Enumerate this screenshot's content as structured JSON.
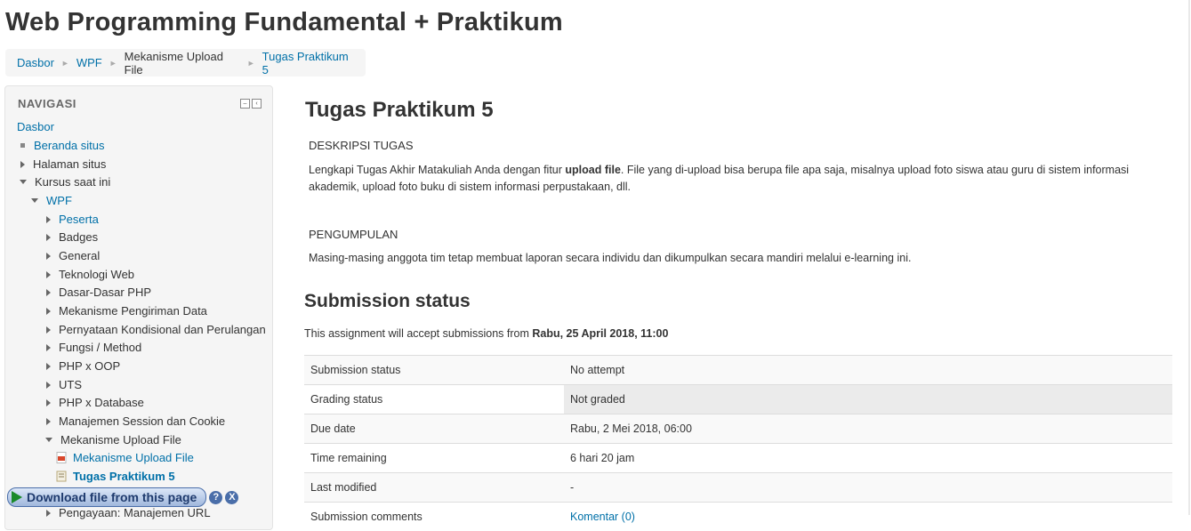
{
  "page": {
    "title": "Web Programming Fundamental + Praktikum"
  },
  "breadcrumb": {
    "items": [
      {
        "label": "Dasbor"
      },
      {
        "label": "WPF"
      },
      {
        "label": "Mekanisme Upload File"
      },
      {
        "label": "Tugas Praktikum 5"
      }
    ],
    "separator": "►"
  },
  "nav": {
    "header": "NAVIGASI",
    "items": [
      {
        "label": "Dasbor"
      },
      {
        "label": "Beranda situs"
      },
      {
        "label": "Halaman situs"
      },
      {
        "label": "Kursus saat ini"
      },
      {
        "label": "WPF"
      },
      {
        "label": "Peserta"
      },
      {
        "label": "Badges"
      },
      {
        "label": "General"
      },
      {
        "label": "Teknologi Web"
      },
      {
        "label": "Dasar-Dasar PHP"
      },
      {
        "label": "Mekanisme Pengiriman Data"
      },
      {
        "label": "Pernyataan Kondisional dan Perulangan"
      },
      {
        "label": "Fungsi / Method"
      },
      {
        "label": "PHP x OOP"
      },
      {
        "label": "UTS"
      },
      {
        "label": "PHP x Database"
      },
      {
        "label": "Manajemen Session dan Cookie"
      },
      {
        "label": "Mekanisme Upload File"
      },
      {
        "label": "Mekanisme Upload File"
      },
      {
        "label": "Tugas Praktikum 5"
      },
      {
        "label": "Pengayaan: Manajemen URL"
      }
    ]
  },
  "download_bar": {
    "label": "Download file from this page",
    "help": "?",
    "close": "X"
  },
  "assignment": {
    "title": "Tugas Praktikum 5",
    "desc_heading": "DESKRIPSI TUGAS",
    "desc_before": "Lengkapi Tugas Akhir Matakuliah Anda dengan fitur ",
    "desc_bold": "upload file",
    "desc_after": ". File yang di-upload bisa berupa file apa saja, misalnya upload foto siswa atau guru di sistem informasi akademik, upload foto buku di sistem informasi perpustakaan, dll.",
    "collect_heading": "PENGUMPULAN",
    "collect_text": "Masing-masing anggota tim tetap membuat laporan secara individu dan dikumpulkan secara mandiri melalui e-learning ini."
  },
  "submission": {
    "heading": "Submission status",
    "accept_prefix": "This assignment will accept submissions from ",
    "accept_date": "Rabu, 25 April 2018, 11:00",
    "rows": [
      {
        "label": "Submission status",
        "value": "No attempt"
      },
      {
        "label": "Grading status",
        "value": "Not graded"
      },
      {
        "label": "Due date",
        "value": "Rabu, 2 Mei 2018, 06:00"
      },
      {
        "label": "Time remaining",
        "value": "6 hari 20 jam"
      },
      {
        "label": "Last modified",
        "value": "-"
      },
      {
        "label": "Submission comments",
        "value": "Komentar (0)"
      }
    ]
  }
}
